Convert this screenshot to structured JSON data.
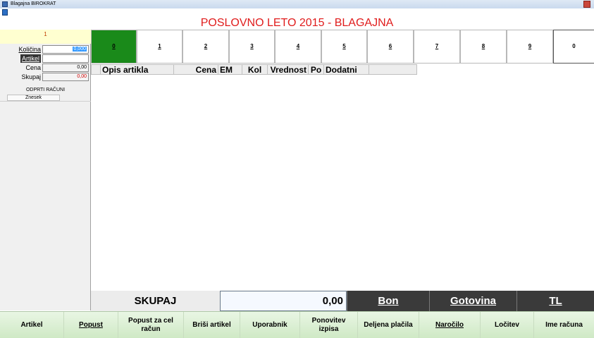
{
  "window": {
    "title": "Blagajna BIROKRAT"
  },
  "banner": "POSLOVNO LETO 2015 - BLAGAJNA",
  "left": {
    "top_value": "1",
    "fields": {
      "kolicina_label": "Količina",
      "kolicina_value": "0,000",
      "artikel_label": "Artikel",
      "artikel_value": "",
      "cena_label": "Cena",
      "cena_value": "0,00",
      "skupaj_label": "Skupaj",
      "skupaj_value": "0,00"
    },
    "open_bills_title": "ODPRTI RAČUNI",
    "znesek_header": "Znesek"
  },
  "tabs": [
    "0",
    "1",
    "2",
    "3",
    "4",
    "5",
    "6",
    "7",
    "8",
    "9",
    "0"
  ],
  "grid": {
    "columns": [
      "",
      "Opis artikla",
      "Cena",
      "EM",
      "Kol",
      "Vrednost",
      "Po",
      "Dodatni",
      ""
    ]
  },
  "totals": {
    "label": "SKUPAJ",
    "value": "0,00",
    "bon": "Bon",
    "gotovina": "Gotovina",
    "tl": "TL"
  },
  "buttons": {
    "artikel": "Artikel",
    "popust": "Popust",
    "popust_cel": "Popust za cel račun",
    "brisi": "Briši artikel",
    "uporabnik": "Uporabnik",
    "ponovitev": "Ponovitev izpisa",
    "deljena": "Deljena plačila",
    "narocilo": "Naročilo",
    "locitev": "Ločitev",
    "ime": "Ime računa"
  },
  "colors": {
    "banner": "#e01c1c",
    "active_tab": "#1a8a1a",
    "pay_buttons": "#3a3a3a",
    "bottom_bar": "#dff0d8"
  }
}
